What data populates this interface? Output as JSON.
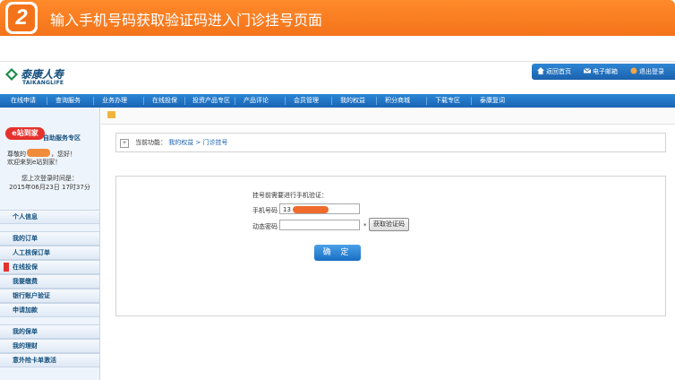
{
  "banner": {
    "step": "2",
    "title": "输入手机号码获取验证码进入门诊挂号页面",
    "color": "#f4731a"
  },
  "header": {
    "logo_cn": "泰康人寿",
    "logo_en": "TAIKANGLIFE",
    "toplinks": [
      "返回首页",
      "电子邮箱",
      "退出登录"
    ]
  },
  "nav": {
    "items": [
      "在线申请",
      "查询服务",
      "业务办理",
      "在线投保",
      "投资产品专区",
      "产品评论",
      "会员管理",
      "我的权益",
      "积分商城",
      "下载专区",
      "泰康复词"
    ]
  },
  "sidebar": {
    "brand": "e站到家",
    "brand_label": "自助服务专区",
    "greeting_prefix": "尊敬的",
    "greeting_suffix": "，您好！",
    "welcome": "欢迎来到e站到家！",
    "last_login_label": "您上次登录时间是：",
    "last_login_time": "2015年06月23日 17时37分",
    "items": [
      "个人信息",
      "我的订单",
      "人工核保订单",
      "在线投保",
      "我要缴费",
      "银行账户验证",
      "申请加款",
      "我的保单",
      "我的理财",
      "意外险卡单激活"
    ]
  },
  "main": {
    "breadcrumb_prefix": "当前功能：",
    "breadcrumb_path": "我的权益 > 门诊挂号",
    "form_title": "挂号前需要进行手机验证：",
    "phone_label": "手机号码",
    "phone_value": "13",
    "code_label": "动态密码",
    "code_value": "",
    "required_mark": "*",
    "get_code_button": "获取验证码",
    "confirm_button": "确 定"
  }
}
